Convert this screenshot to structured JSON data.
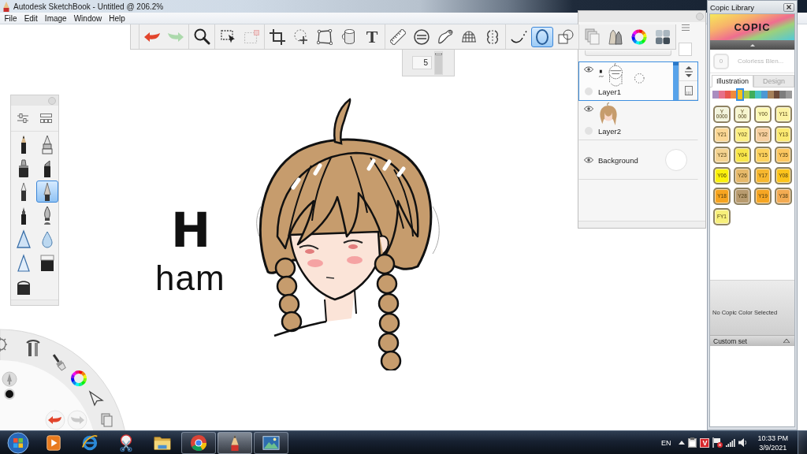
{
  "window": {
    "title": "Autodesk SketchBook - Untitled @ 206.2%"
  },
  "menu": [
    "File",
    "Edit",
    "Image",
    "Window",
    "Help"
  ],
  "toolbar": {
    "groups": [
      [
        {
          "kind": "undo",
          "selected": false,
          "disabled": false
        },
        {
          "kind": "redo",
          "selected": false,
          "disabled": true
        }
      ],
      [
        {
          "kind": "zoom",
          "selected": false,
          "disabled": false
        }
      ],
      [
        {
          "kind": "select",
          "selected": false,
          "disabled": false
        },
        {
          "kind": "select-clear",
          "selected": false,
          "disabled": true
        }
      ],
      [
        {
          "kind": "crop",
          "selected": false,
          "disabled": false
        },
        {
          "kind": "transform",
          "selected": false,
          "disabled": false
        },
        {
          "kind": "distort",
          "selected": false,
          "disabled": false
        },
        {
          "kind": "fill",
          "selected": false,
          "disabled": false
        },
        {
          "kind": "text",
          "label": "T",
          "selected": false,
          "disabled": false
        }
      ],
      [
        {
          "kind": "ruler",
          "selected": false,
          "disabled": false
        },
        {
          "kind": "ellipse-guide",
          "selected": false,
          "disabled": false
        },
        {
          "kind": "french-curve",
          "selected": false,
          "disabled": false
        },
        {
          "kind": "perspective",
          "selected": false,
          "disabled": false
        },
        {
          "kind": "symmetry",
          "selected": false,
          "disabled": false
        }
      ],
      [
        {
          "kind": "steady-stroke",
          "selected": false,
          "disabled": false
        },
        {
          "kind": "ellipse",
          "selected": true,
          "disabled": false
        },
        {
          "kind": "shapes",
          "selected": false,
          "disabled": false
        }
      ],
      [
        {
          "kind": "layers",
          "selected": false,
          "disabled": false
        },
        {
          "kind": "brushes",
          "selected": false,
          "disabled": false
        },
        {
          "kind": "color-wheel",
          "selected": false,
          "disabled": false
        },
        {
          "kind": "copic",
          "selected": false,
          "disabled": false
        }
      ]
    ]
  },
  "brush_size": {
    "value": "5",
    "level": 0.95
  },
  "layers": {
    "rows": [
      {
        "kind": "lineart",
        "name": "Layer1",
        "visible": true,
        "selected": true
      },
      {
        "kind": "fill",
        "name": "Layer2",
        "visible": true,
        "selected": false
      },
      {
        "kind": "background",
        "name": "Background",
        "visible": true,
        "selected": false
      }
    ]
  },
  "brush_palette": {
    "brushes": [
      {
        "kind": "pencil",
        "selected": false
      },
      {
        "kind": "airbrush",
        "selected": false
      },
      {
        "kind": "marker",
        "selected": false
      },
      {
        "kind": "chisel-marker",
        "selected": false
      },
      {
        "kind": "ballpoint",
        "selected": false
      },
      {
        "kind": "ink-pen",
        "selected": true
      },
      {
        "kind": "felt-pen",
        "selected": false
      },
      {
        "kind": "nib-pen",
        "selected": false
      },
      {
        "kind": "smudge",
        "selected": false
      },
      {
        "kind": "blur",
        "selected": false
      },
      {
        "kind": "sharpen",
        "selected": false
      },
      {
        "kind": "hard-eraser",
        "selected": false
      },
      {
        "kind": "soft-eraser",
        "selected": false
      }
    ]
  },
  "canvas": {
    "lettering": [
      {
        "kind": "bold",
        "text": "H"
      },
      {
        "kind": "script",
        "text": "ham"
      }
    ]
  },
  "lagoon": {
    "ring": [
      {
        "kind": "settings"
      },
      {
        "kind": "tools"
      },
      {
        "kind": "brush"
      },
      {
        "kind": "color-wheel"
      },
      {
        "kind": "select"
      },
      {
        "kind": "layers"
      }
    ],
    "history": [
      {
        "kind": "undo",
        "disabled": false
      },
      {
        "kind": "redo",
        "disabled": true
      }
    ]
  },
  "copic_library": {
    "title": "Copic Library",
    "logo": "COPIC",
    "blender": {
      "code": "0",
      "label": "Colorless Blen..."
    },
    "tabs": [
      {
        "label": "Illustration",
        "selected": true
      },
      {
        "label": "Design",
        "selected": false
      }
    ],
    "families": [
      {
        "color": "#a98dc0",
        "selected": false
      },
      {
        "color": "#e6708a",
        "selected": false
      },
      {
        "color": "#e9574f",
        "selected": false
      },
      {
        "color": "#f08a3c",
        "selected": false
      },
      {
        "color": "#f5c21a",
        "selected": true
      },
      {
        "color": "#a9cb49",
        "selected": false
      },
      {
        "color": "#3fae5b",
        "selected": false
      },
      {
        "color": "#45c3c6",
        "selected": false
      },
      {
        "color": "#4c98d4",
        "selected": false
      },
      {
        "color": "#a6805a",
        "selected": false
      },
      {
        "color": "#6c4a3a",
        "selected": false
      },
      {
        "color": "#7d7d7d",
        "selected": false
      },
      {
        "color": "#9a9a9a",
        "selected": false
      }
    ],
    "swatches": [
      {
        "code": "Y\n0000",
        "color": "#f2f4dc"
      },
      {
        "code": "Y\n000",
        "color": "#f6f5cf"
      },
      {
        "code": "Y00",
        "color": "#fcf8b2"
      },
      {
        "code": "Y11",
        "color": "#fbf2a1"
      },
      {
        "code": "Y21",
        "color": "#fbd795"
      },
      {
        "code": "Y02",
        "color": "#fbee82"
      },
      {
        "code": "Y32",
        "color": "#f7cf9f"
      },
      {
        "code": "Y13",
        "color": "#fbe970"
      },
      {
        "code": "Y23",
        "color": "#f4d390"
      },
      {
        "code": "Y04",
        "color": "#f8e649"
      },
      {
        "code": "Y15",
        "color": "#fdd15c"
      },
      {
        "code": "Y35",
        "color": "#fcc65f"
      },
      {
        "code": "Y06",
        "color": "#fbf10a"
      },
      {
        "code": "Y26",
        "color": "#e6b96a"
      },
      {
        "code": "Y17",
        "color": "#f7b72e"
      },
      {
        "code": "Y08",
        "color": "#fcc31b"
      },
      {
        "code": "Y18",
        "color": "#f6a41f"
      },
      {
        "code": "Y28",
        "color": "#b89b6f"
      },
      {
        "code": "Y19",
        "color": "#f6a623"
      },
      {
        "code": "Y38",
        "color": "#f3ab52"
      },
      {
        "code": "FY1",
        "color": "#f7ef7a"
      }
    ],
    "status": "No Copic Color Selected",
    "custom_set": {
      "label": "Custom set"
    }
  },
  "taskbar": {
    "apps": [
      {
        "kind": "media-player",
        "running": false,
        "selected": false
      },
      {
        "kind": "internet-browser",
        "running": false,
        "selected": false
      },
      {
        "kind": "snipping-tool",
        "running": false,
        "selected": false
      },
      {
        "kind": "file-explorer",
        "running": false,
        "selected": false
      },
      {
        "kind": "web-browser",
        "running": true,
        "selected": false
      },
      {
        "kind": "sketch-app",
        "running": true,
        "selected": true
      },
      {
        "kind": "photo-viewer",
        "running": true,
        "selected": false
      }
    ],
    "tray": {
      "language": "EN",
      "icons": [
        {
          "kind": "show-hidden"
        },
        {
          "kind": "clipboard"
        },
        {
          "kind": "letter",
          "label": "V"
        },
        {
          "kind": "flag"
        },
        {
          "kind": "signal"
        },
        {
          "kind": "speaker"
        }
      ],
      "time": "10:33 PM",
      "date": "3/9/2021"
    }
  }
}
